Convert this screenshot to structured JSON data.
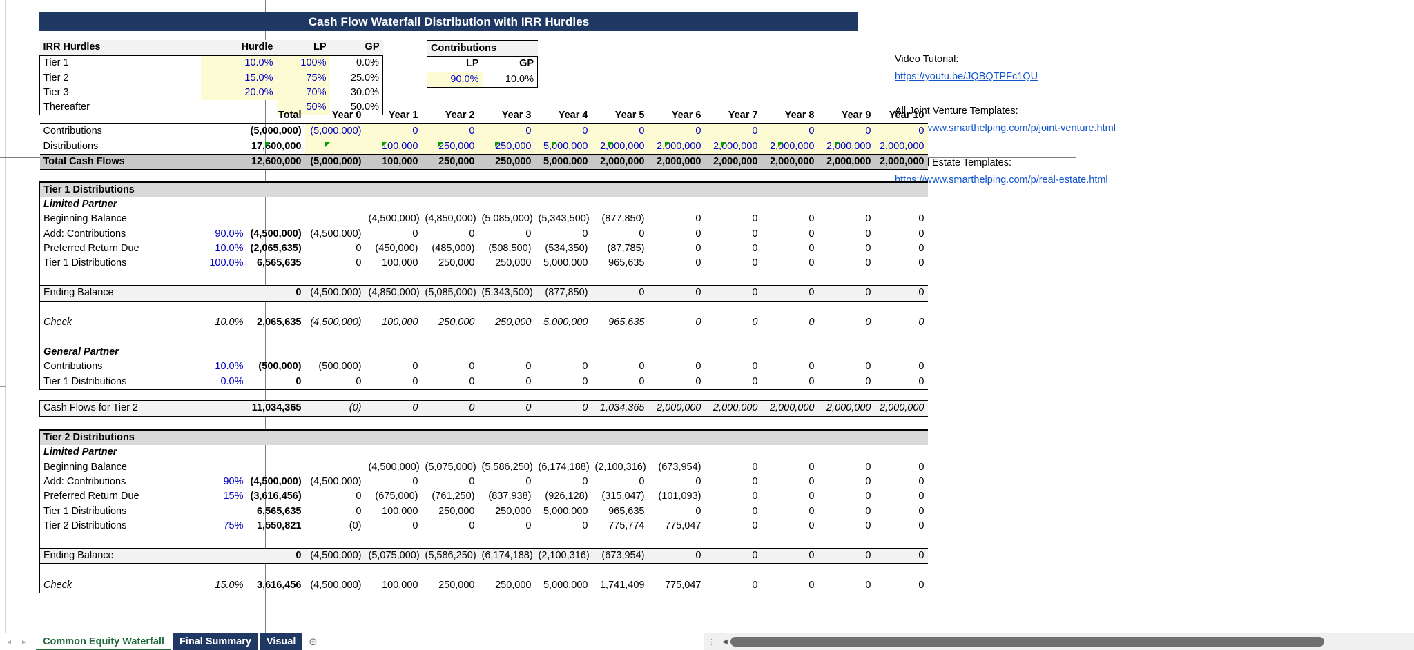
{
  "title": "Cash Flow Waterfall Distribution with IRR Hurdles",
  "colors": {
    "banner": "#1f3864",
    "input": "#fdfbd4",
    "link": "#1155cc",
    "blue_text": "#0000c0",
    "active_tab": "#1f6b3a"
  },
  "irr_hurdles": {
    "header": {
      "name": "IRR Hurdles",
      "hurdle": "Hurdle",
      "lp": "LP",
      "gp": "GP"
    },
    "rows": [
      {
        "name": "Tier 1",
        "hurdle": "10.0%",
        "lp": "100%",
        "gp": "0.0%"
      },
      {
        "name": "Tier 2",
        "hurdle": "15.0%",
        "lp": "75%",
        "gp": "25.0%"
      },
      {
        "name": "Tier 3",
        "hurdle": "20.0%",
        "lp": "70%",
        "gp": "30.0%"
      },
      {
        "name": "Thereafter",
        "hurdle": "",
        "lp": "50%",
        "gp": "50.0%"
      }
    ]
  },
  "contributions_box": {
    "title": "Contributions",
    "lp_label": "LP",
    "gp_label": "GP",
    "lp_value": "90.0%",
    "gp_value": "10.0%"
  },
  "columns": {
    "total": "Total",
    "years": [
      "Year 0",
      "Year 1",
      "Year 2",
      "Year 3",
      "Year 4",
      "Year 5",
      "Year 6",
      "Year 7",
      "Year 8",
      "Year 9",
      "Year 10"
    ]
  },
  "cash_flows": [
    {
      "label": "Contributions",
      "pct": "",
      "total": "(5,000,000)",
      "values": [
        "(5,000,000)",
        "0",
        "0",
        "0",
        "0",
        "0",
        "0",
        "0",
        "0",
        "0",
        "0"
      ]
    },
    {
      "label": "Distributions",
      "pct": "",
      "total": "17,600,000",
      "values": [
        "",
        "100,000",
        "250,000",
        "250,000",
        "5,000,000",
        "2,000,000",
        "2,000,000",
        "2,000,000",
        "2,000,000",
        "2,000,000",
        "2,000,000"
      ]
    },
    {
      "label": "Total Cash Flows",
      "pct": "",
      "total": "12,600,000",
      "values": [
        "(5,000,000)",
        "100,000",
        "250,000",
        "250,000",
        "5,000,000",
        "2,000,000",
        "2,000,000",
        "2,000,000",
        "2,000,000",
        "2,000,000",
        "2,000,000"
      ]
    }
  ],
  "tier1": {
    "heading": "Tier 1 Distributions",
    "lp_heading": "Limited Partner",
    "gp_heading": "General Partner",
    "lp_rows": [
      {
        "label": "Beginning Balance",
        "pct": "",
        "total": "",
        "values": [
          "",
          "(4,500,000)",
          "(4,850,000)",
          "(5,085,000)",
          "(5,343,500)",
          "(877,850)",
          "0",
          "0",
          "0",
          "0",
          "0"
        ]
      },
      {
        "label": "Add: Contributions",
        "pct": "90.0%",
        "total": "(4,500,000)",
        "values": [
          "(4,500,000)",
          "0",
          "0",
          "0",
          "0",
          "0",
          "0",
          "0",
          "0",
          "0",
          "0"
        ]
      },
      {
        "label": "Preferred Return Due",
        "pct": "10.0%",
        "total": "(2,065,635)",
        "values": [
          "0",
          "(450,000)",
          "(485,000)",
          "(508,500)",
          "(534,350)",
          "(87,785)",
          "0",
          "0",
          "0",
          "0",
          "0"
        ]
      },
      {
        "label": "Tier 1 Distributions",
        "pct": "100.0%",
        "total": "6,565,635",
        "values": [
          "0",
          "100,000",
          "250,000",
          "250,000",
          "5,000,000",
          "965,635",
          "0",
          "0",
          "0",
          "0",
          "0"
        ]
      }
    ],
    "ending": {
      "label": "Ending Balance",
      "pct": "",
      "total": "0",
      "values": [
        "(4,500,000)",
        "(4,850,000)",
        "(5,085,000)",
        "(5,343,500)",
        "(877,850)",
        "0",
        "0",
        "0",
        "0",
        "0",
        "0"
      ]
    },
    "check": {
      "label": "Check",
      "pct": "10.0%",
      "total": "2,065,635",
      "values": [
        "(4,500,000)",
        "100,000",
        "250,000",
        "250,000",
        "5,000,000",
        "965,635",
        "0",
        "0",
        "0",
        "0",
        "0"
      ]
    },
    "gp_rows": [
      {
        "label": "Contributions",
        "pct": "10.0%",
        "total": "(500,000)",
        "values": [
          "(500,000)",
          "0",
          "0",
          "0",
          "0",
          "0",
          "0",
          "0",
          "0",
          "0",
          "0"
        ]
      },
      {
        "label": "Tier 1 Distributions",
        "pct": "0.0%",
        "total": "0",
        "values": [
          "0",
          "0",
          "0",
          "0",
          "0",
          "0",
          "0",
          "0",
          "0",
          "0",
          "0"
        ]
      }
    ],
    "cash_flows_next": {
      "label": "Cash Flows for Tier 2",
      "pct": "",
      "total": "11,034,365",
      "values": [
        "(0)",
        "0",
        "0",
        "0",
        "0",
        "1,034,365",
        "2,000,000",
        "2,000,000",
        "2,000,000",
        "2,000,000",
        "2,000,000"
      ]
    }
  },
  "tier2": {
    "heading": "Tier 2 Distributions",
    "lp_heading": "Limited Partner",
    "lp_rows": [
      {
        "label": "Beginning Balance",
        "pct": "",
        "total": "",
        "values": [
          "",
          "(4,500,000)",
          "(5,075,000)",
          "(5,586,250)",
          "(6,174,188)",
          "(2,100,316)",
          "(673,954)",
          "0",
          "0",
          "0",
          "0"
        ]
      },
      {
        "label": "Add: Contributions",
        "pct": "90%",
        "total": "(4,500,000)",
        "values": [
          "(4,500,000)",
          "0",
          "0",
          "0",
          "0",
          "0",
          "0",
          "0",
          "0",
          "0",
          "0"
        ]
      },
      {
        "label": "Preferred Return Due",
        "pct": "15%",
        "total": "(3,616,456)",
        "values": [
          "0",
          "(675,000)",
          "(761,250)",
          "(837,938)",
          "(926,128)",
          "(315,047)",
          "(101,093)",
          "0",
          "0",
          "0",
          "0"
        ]
      },
      {
        "label": "Tier 1 Distributions",
        "pct": "",
        "total": "6,565,635",
        "values": [
          "0",
          "100,000",
          "250,000",
          "250,000",
          "5,000,000",
          "965,635",
          "0",
          "0",
          "0",
          "0",
          "0"
        ]
      },
      {
        "label": "Tier 2 Distributions",
        "pct": "75%",
        "total": "1,550,821",
        "values": [
          "(0)",
          "0",
          "0",
          "0",
          "0",
          "775,774",
          "775,047",
          "0",
          "0",
          "0",
          "0"
        ]
      }
    ],
    "ending": {
      "label": "Ending Balance",
      "pct": "",
      "total": "0",
      "values": [
        "(4,500,000)",
        "(5,075,000)",
        "(5,586,250)",
        "(6,174,188)",
        "(2,100,316)",
        "(673,954)",
        "0",
        "0",
        "0",
        "0",
        "0"
      ]
    },
    "check": {
      "label": "Check",
      "pct": "15.0%",
      "total": "3,616,456",
      "values": [
        "(4,500,000)",
        "100,000",
        "250,000",
        "250,000",
        "5,000,000",
        "1,741,409",
        "775,047",
        "0",
        "0",
        "0",
        "0"
      ]
    }
  },
  "side_links": {
    "video_label": "Video Tutorial:",
    "video_url": "https://youtu.be/JQBQTPFc1QU",
    "jv_label": "All Joint Venture Templates:",
    "jv_url": "https://www.smarthelping.com/p/joint-venture.html",
    "re_label": "All Real Estate Templates:",
    "re_url": "https://www.smarthelping.com/p/real-estate.html"
  },
  "tabs": [
    {
      "label": "Common Equity Waterfall",
      "active": true
    },
    {
      "label": "Final Summary",
      "active": false
    },
    {
      "label": "Visual",
      "active": false
    }
  ],
  "tab_controls": {
    "prev": "◂",
    "next": "▸",
    "add": "⊕"
  }
}
